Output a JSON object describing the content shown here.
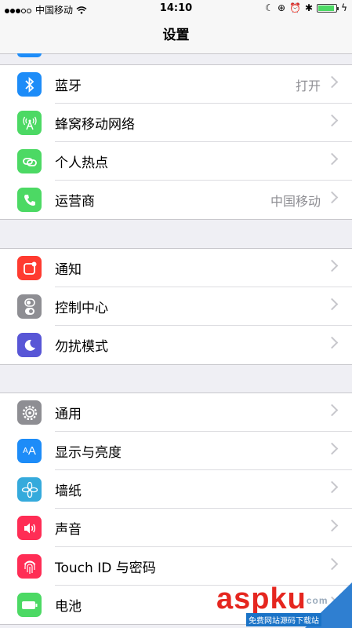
{
  "status": {
    "carrier": "中国移动",
    "time": "14:10"
  },
  "nav": {
    "title": "设置"
  },
  "groups": [
    {
      "items": [
        {
          "label": "蓝牙",
          "value": "打开",
          "icon": "bluetooth-icon",
          "color": "#1d8cf8"
        },
        {
          "label": "蜂窝移动网络",
          "value": "",
          "icon": "cellular-icon",
          "color": "#4cd964"
        },
        {
          "label": "个人热点",
          "value": "",
          "icon": "hotspot-icon",
          "color": "#4cd964"
        },
        {
          "label": "运营商",
          "value": "中国移动",
          "icon": "phone-icon",
          "color": "#4cd964"
        }
      ]
    },
    {
      "items": [
        {
          "label": "通知",
          "icon": "notifications-icon",
          "color": "#ff3b30"
        },
        {
          "label": "控制中心",
          "icon": "control-center-icon",
          "color": "#8e8e93"
        },
        {
          "label": "勿扰模式",
          "icon": "moon-icon",
          "color": "#5856d6"
        }
      ]
    },
    {
      "items": [
        {
          "label": "通用",
          "icon": "gear-icon",
          "color": "#8e8e93"
        },
        {
          "label": "显示与亮度",
          "icon": "display-icon",
          "color": "#1d8cf8"
        },
        {
          "label": "墙纸",
          "icon": "wallpaper-icon",
          "color": "#35aadc"
        },
        {
          "label": "声音",
          "icon": "sound-icon",
          "color": "#ff2d55"
        },
        {
          "label": "Touch ID 与密码",
          "icon": "fingerprint-icon",
          "color": "#ff2d55"
        },
        {
          "label": "电池",
          "icon": "battery-icon",
          "color": "#4cd964"
        }
      ]
    }
  ],
  "watermark": {
    "text": "aspku",
    "domain": "com",
    "sub": "免费网站源码下载站"
  }
}
